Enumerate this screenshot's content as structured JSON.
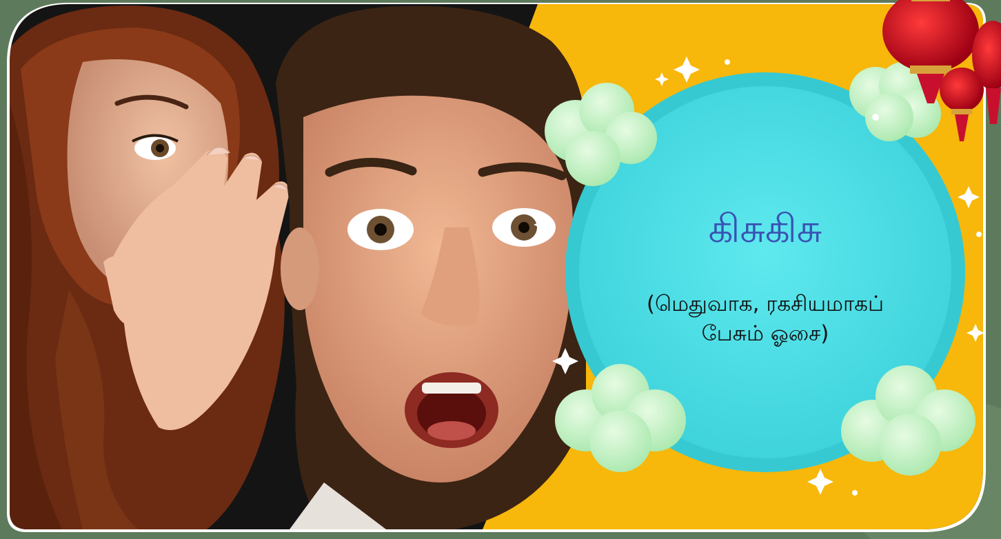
{
  "card": {
    "word": "கிசுகிசு",
    "meaning_line1": "(மெதுவாக, ரகசியமாகப்",
    "meaning_line2": "பேசும் ஓசை)"
  },
  "colors": {
    "background": "#5e7a5c",
    "panel": "#f7b70b",
    "circle": "#4fe0e6",
    "cloud": "#c9f3c9",
    "title": "#3a52b3",
    "lantern": "#c8102e",
    "border": "#ffffff"
  },
  "icons": [
    "lantern-icon",
    "sparkle-icon",
    "cloud-icon"
  ]
}
